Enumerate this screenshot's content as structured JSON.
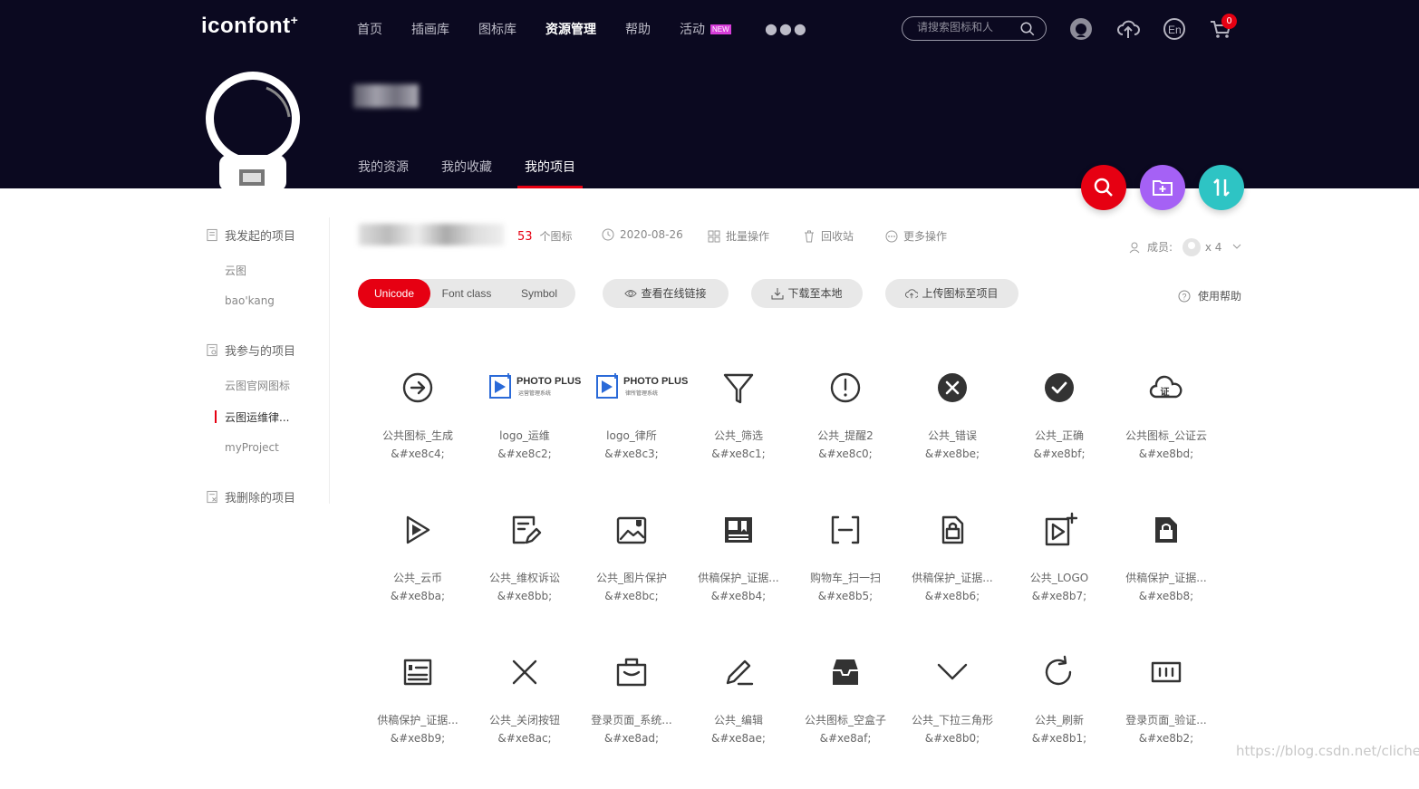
{
  "brand": {
    "name": "iconfont",
    "plus": "+"
  },
  "nav": [
    {
      "label": "首页"
    },
    {
      "label": "插画库"
    },
    {
      "label": "图标库"
    },
    {
      "label": "资源管理"
    },
    {
      "label": "帮助"
    },
    {
      "label": "活动",
      "badge": "NEW"
    }
  ],
  "search": {
    "placeholder": "请搜索图标和人"
  },
  "cart": {
    "count": "0"
  },
  "subtabs": [
    {
      "label": "我的资源"
    },
    {
      "label": "我的收藏"
    },
    {
      "label": "我的项目"
    }
  ],
  "sidebar": {
    "started": {
      "title": "我发起的项目",
      "items": [
        "云图",
        "bao'kang"
      ]
    },
    "joined": {
      "title": "我参与的项目",
      "items": [
        "云图官网图标",
        "云图运维律...",
        "myProject"
      ]
    },
    "deleted": {
      "title": "我删除的项目"
    }
  },
  "project": {
    "icon_count": "53",
    "icon_count_unit": "个图标",
    "date": "2020-08-26",
    "batch": "批量操作",
    "recycle": "回收站",
    "more": "更多操作",
    "members_label": "成员:",
    "members_count": "x 4"
  },
  "toolbar": {
    "modes": [
      "Unicode",
      "Font class",
      "Symbol"
    ],
    "view_online": "查看在线链接",
    "download": "下载至本地",
    "upload": "上传图标至项目",
    "help": "使用帮助"
  },
  "icons": [
    {
      "name": "公共图标_生成",
      "code": "&#xe8c4;",
      "icon": "arrow-circle-right-icon"
    },
    {
      "name": "logo_运维",
      "code": "&#xe8c2;",
      "icon": "photo-plus-logo",
      "logo_title": "PHOTO PLUS",
      "logo_sub": "运营管理系统"
    },
    {
      "name": "logo_律所",
      "code": "&#xe8c3;",
      "icon": "photo-plus-logo",
      "logo_title": "PHOTO PLUS",
      "logo_sub": "律所管理系统"
    },
    {
      "name": "公共_筛选",
      "code": "&#xe8c1;",
      "icon": "filter-icon"
    },
    {
      "name": "公共_提醒2",
      "code": "&#xe8c0;",
      "icon": "alert-circle-icon"
    },
    {
      "name": "公共_错误",
      "code": "&#xe8be;",
      "icon": "error-circle-icon"
    },
    {
      "name": "公共_正确",
      "code": "&#xe8bf;",
      "icon": "check-circle-icon"
    },
    {
      "name": "公共图标_公证云",
      "code": "&#xe8bd;",
      "icon": "cloud-cert-icon",
      "cert_char": "证"
    },
    {
      "name": "公共_云币",
      "code": "&#xe8ba;",
      "icon": "play-coin-icon"
    },
    {
      "name": "公共_维权诉讼",
      "code": "&#xe8bb;",
      "icon": "document-edit-icon"
    },
    {
      "name": "公共_图片保护",
      "code": "&#xe8bc;",
      "icon": "image-shield-icon"
    },
    {
      "name": "供稿保护_证据...",
      "code": "&#xe8b4;",
      "icon": "evidence-book-icon"
    },
    {
      "name": "购物车_扫一扫",
      "code": "&#xe8b5;",
      "icon": "scan-icon"
    },
    {
      "name": "供稿保护_证据...",
      "code": "&#xe8b6;",
      "icon": "document-lock-icon"
    },
    {
      "name": "公共_LOGO",
      "code": "&#xe8b7;",
      "icon": "logo-plus-icon"
    },
    {
      "name": "供稿保护_证据...",
      "code": "&#xe8b8;",
      "icon": "document-lock-filled-icon"
    },
    {
      "name": "供稿保护_证据...",
      "code": "&#xe8b9;",
      "icon": "certificate-icon"
    },
    {
      "name": "公共_关闭按钮",
      "code": "&#xe8ac;",
      "icon": "close-icon"
    },
    {
      "name": "登录页面_系统...",
      "code": "&#xe8ad;",
      "icon": "briefcase-icon"
    },
    {
      "name": "公共_编辑",
      "code": "&#xe8ae;",
      "icon": "edit-icon"
    },
    {
      "name": "公共图标_空盒子",
      "code": "&#xe8af;",
      "icon": "empty-box-icon"
    },
    {
      "name": "公共_下拉三角形",
      "code": "&#xe8b0;",
      "icon": "chevron-down-icon"
    },
    {
      "name": "公共_刷新",
      "code": "&#xe8b1;",
      "icon": "refresh-icon"
    },
    {
      "name": "登录页面_验证...",
      "code": "&#xe8b2;",
      "icon": "captcha-icon"
    }
  ],
  "watermark": "https://blog.csdn.net/clichen",
  "colors": {
    "header_bg": "#0b0920",
    "accent": "#e60012",
    "fab_purple": "#a561f5",
    "fab_teal": "#2ec4c4",
    "logo_blue": "#2a6ad8"
  }
}
